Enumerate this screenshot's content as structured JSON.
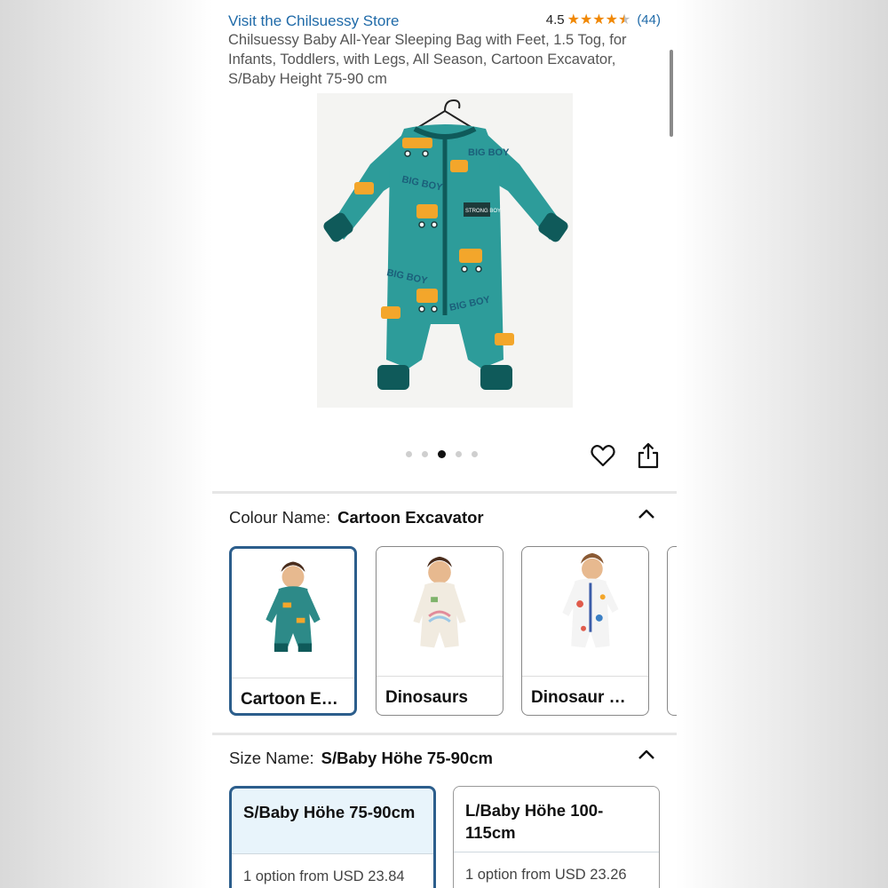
{
  "header": {
    "store_link": "Visit the Chilsuessy Store",
    "rating_value": "4.5",
    "rating_count": "(44)",
    "stars_filled": 4.5
  },
  "product": {
    "title": "Chilsuessy Baby All-Year Sleeping Bag with Feet, 1.5 Tog, for Infants, Toddlers, with Legs, All Season, Cartoon Excavator, S/Baby Height 75-90 cm",
    "image_text_big_boy": "BIG BOY",
    "image_text_patch": "STRONG BOY"
  },
  "carousel": {
    "total": 5,
    "active": 3
  },
  "colour": {
    "label": "Colour Name:",
    "value": "Cartoon Excavator",
    "options": [
      {
        "label": "Cartoon E…",
        "selected": true
      },
      {
        "label": "Dinosaurs",
        "selected": false
      },
      {
        "label": "Dinosaur …",
        "selected": false
      }
    ]
  },
  "size": {
    "label": "Size Name:",
    "value": "S/Baby Höhe 75-90cm",
    "options": [
      {
        "name": "S/Baby Höhe 75-90cm",
        "price": "1 option from USD 23.84",
        "selected": true
      },
      {
        "name": "L/Baby Höhe 100-115cm",
        "price": "1 option from USD 23.26",
        "selected": false
      }
    ]
  },
  "colors": {
    "link": "#1f6aa8",
    "star": "#f08804",
    "selected_border": "#2c5e8c",
    "garment": "#2d9c9a"
  }
}
